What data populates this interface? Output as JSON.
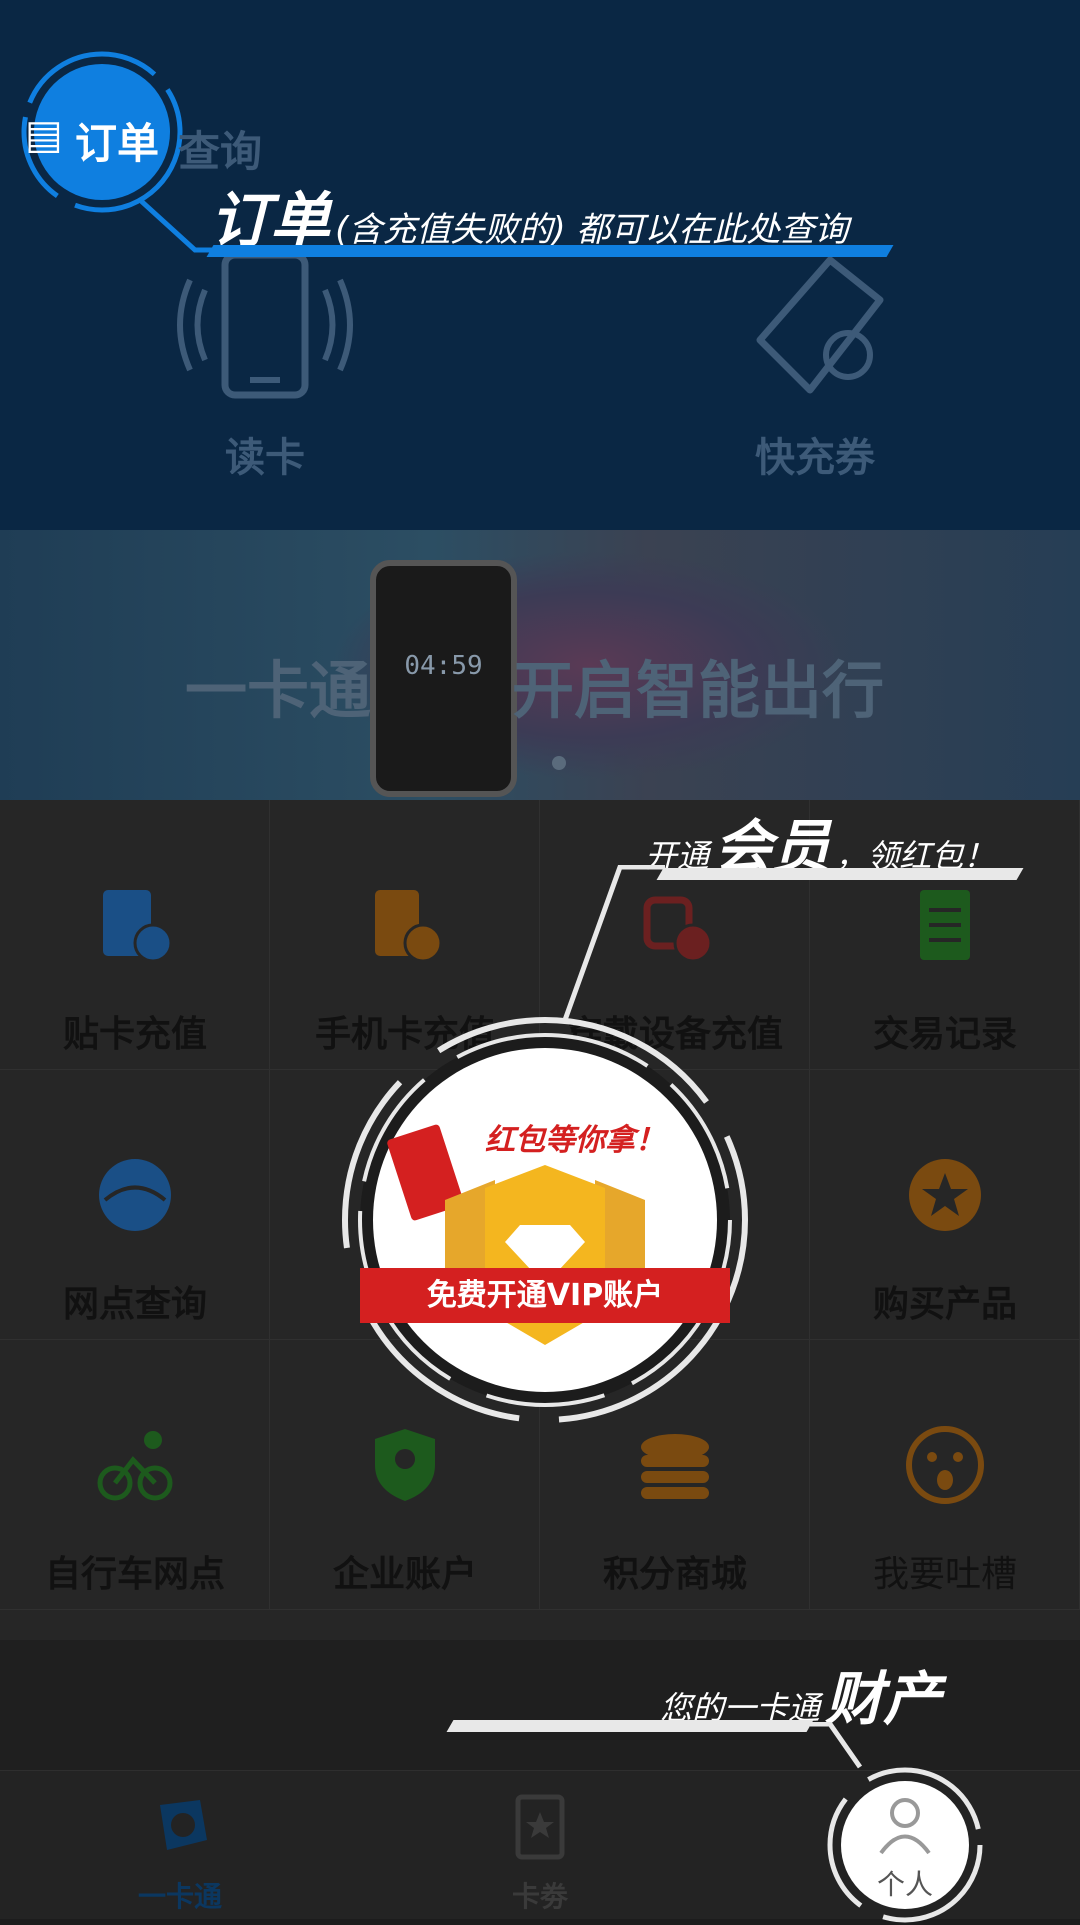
{
  "top": {
    "read_card_label": "读卡",
    "coupon_label": "快充券",
    "order_badge_label": "订单",
    "order_badge_suffix": "查询"
  },
  "banner": {
    "left_text": "一卡通",
    "right_text": "开启智能出行",
    "watch_time": "04:59"
  },
  "grid": {
    "items": [
      {
        "label": "贴卡充值",
        "icon": "card-recharge-icon",
        "color": "#1a4f86"
      },
      {
        "label": "手机卡充值",
        "icon": "phone-card-recharge-icon",
        "color": "#7a4a10"
      },
      {
        "label": "穿戴设备充值",
        "icon": "wearable-recharge-icon",
        "color": "#6b2020"
      },
      {
        "label": "交易记录",
        "icon": "transaction-record-icon",
        "color": "#1d5a1d"
      },
      {
        "label": "网点查询",
        "icon": "globe-icon",
        "color": "#1a4f86"
      },
      {
        "label": "",
        "icon": "",
        "color": ""
      },
      {
        "label": "",
        "icon": "",
        "color": ""
      },
      {
        "label": "购买产品",
        "icon": "star-icon",
        "color": "#7a4a10"
      },
      {
        "label": "自行车网点",
        "icon": "bicycle-icon",
        "color": "#1d5a1d"
      },
      {
        "label": "企业账户",
        "icon": "shield-user-icon",
        "color": "#1d5a1d"
      },
      {
        "label": "积分商城",
        "icon": "coins-icon",
        "color": "#7a4a10"
      },
      {
        "label": "我要吐槽",
        "icon": "shocked-face-icon",
        "color": "#7a4a10"
      }
    ]
  },
  "callouts": {
    "order_big": "订单",
    "order_small": "(含充值失败的) 都可以在此处查询",
    "vip_pre": "开通",
    "vip_big": "会员",
    "vip_post": "，领红包！",
    "asset_pre": "您的一卡通",
    "asset_big": "财产"
  },
  "vip_popup": {
    "ribbon_text": "免费开通VIP账户",
    "top_text": "红包等你拿！"
  },
  "tabs": [
    {
      "label": "一卡通",
      "icon": "yikatong-logo-icon"
    },
    {
      "label": "卡劵",
      "icon": "coupon-tab-icon"
    },
    {
      "label": "个人",
      "icon": "person-icon"
    }
  ],
  "colors": {
    "accent_blue": "#0f7fe0",
    "top_bg": "#0a2744"
  }
}
